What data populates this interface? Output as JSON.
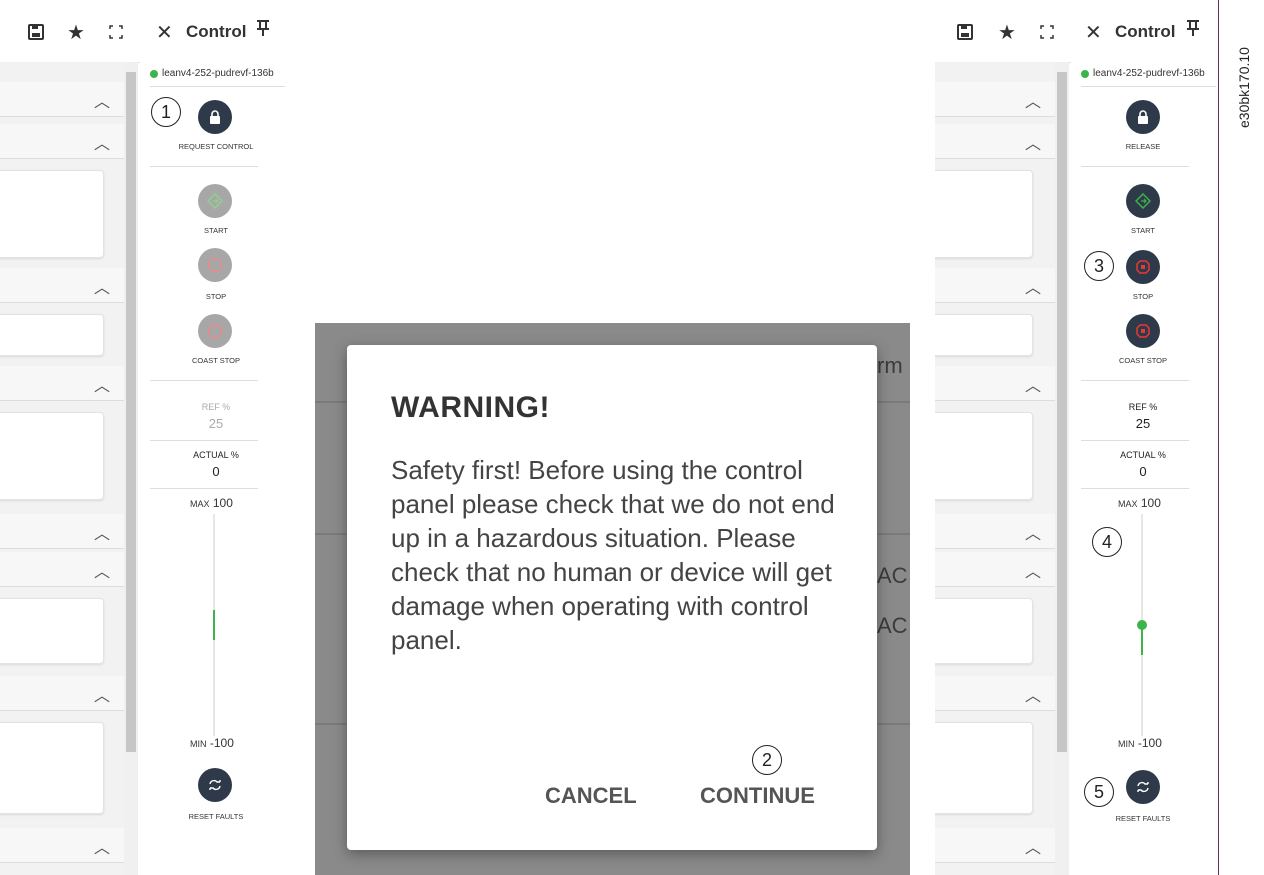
{
  "control_title": "Control",
  "device_name": "leanv4-252-pudrevf-136b",
  "left": {
    "request_control_label": "REQUEST CONTROL",
    "start_label": "START",
    "stop_label": "STOP",
    "coast_stop_label": "COAST STOP",
    "ref_label": "REF %",
    "ref_value": "25",
    "actual_label": "ACTUAL %",
    "actual_value": "0",
    "max_label": "MAX",
    "max_value": "100",
    "min_label": "MIN",
    "min_value": "-100",
    "reset_faults_label": "RESET FAULTS",
    "slider_level": 0.5
  },
  "right": {
    "release_label": "RELEASE",
    "start_label": "START",
    "stop_label": "STOP",
    "coast_stop_label": "COAST STOP",
    "ref_label": "REF %",
    "ref_value": "25",
    "actual_label": "ACTUAL %",
    "actual_value": "0",
    "max_label": "MAX",
    "max_value": "100",
    "min_label": "MIN",
    "min_value": "-100",
    "reset_faults_label": "RESET FAULTS",
    "slider_level": 0.5
  },
  "dialog": {
    "title": "WARNING!",
    "body": "Safety first! Before using the control panel please check that we do not end up in a hazardous situation. Please check that no human or device will get damage when operating with control panel.",
    "cancel_label": "CANCEL",
    "continue_label": "CONTINUE"
  },
  "background_fragments": {
    "frag1": "rm",
    "frag2": "AC",
    "frag3": "AC"
  },
  "callouts": [
    "1",
    "2",
    "3",
    "4",
    "5"
  ],
  "document_code": "e30bk170.10",
  "colors": {
    "button_dark": "#2e3a4a",
    "status_green": "#3cb44b",
    "stop_red": "#e53935",
    "disabled_grey": "#a7a7a7"
  },
  "icons": {
    "save": "save-icon",
    "favorite": "star-icon",
    "fullscreen": "fullscreen-icon",
    "close": "close-icon",
    "pin": "pin-icon",
    "chevron": "chevron-up-icon",
    "lock": "lock-icon",
    "start": "diamond-start-icon",
    "stop": "stop-octagon-icon",
    "reset": "reset-arrows-icon"
  }
}
